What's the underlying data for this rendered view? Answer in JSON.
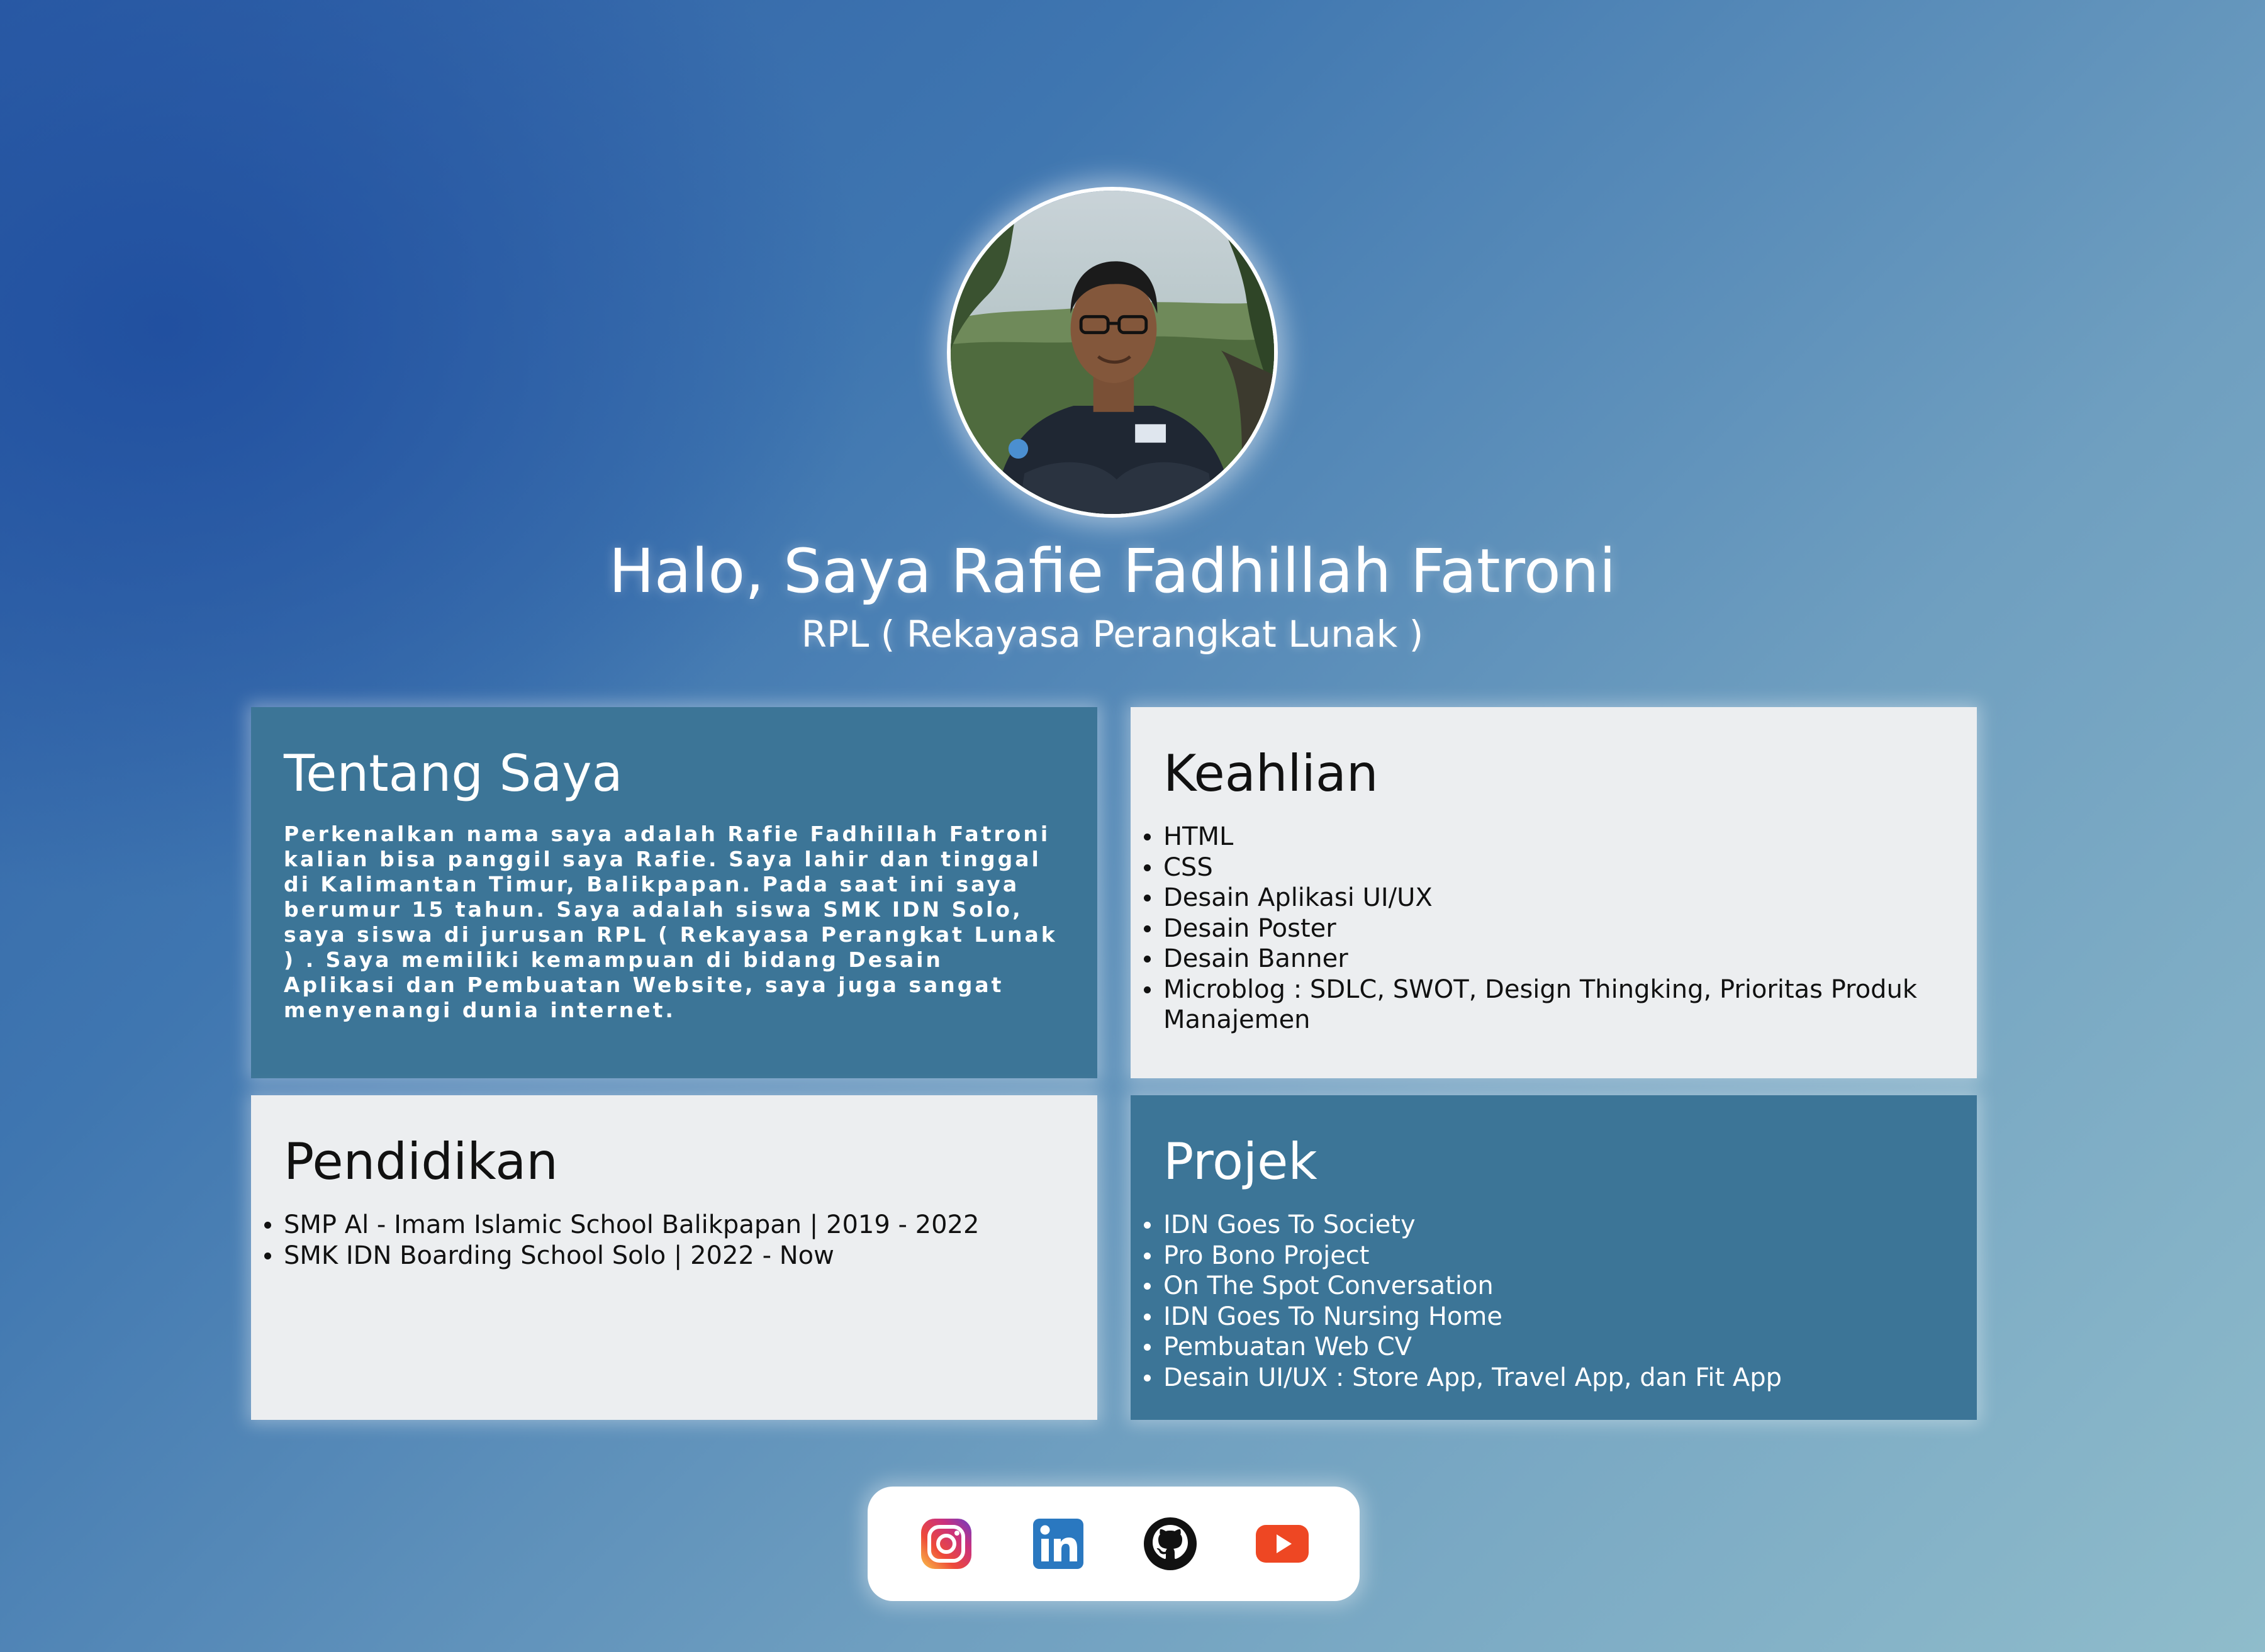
{
  "hero": {
    "name": "Halo, Saya Rafie Fadhillah Fatroni",
    "subtitle": "RPL ( Rekayasa Perangkat Lunak )",
    "avatar_alt": "profile-photo"
  },
  "about": {
    "title": "Tentang Saya",
    "text": "Perkenalkan nama saya adalah Rafie Fadhillah Fatroni kalian bisa panggil saya Rafie. Saya lahir dan tinggal di Kalimantan Timur, Balikpapan. Pada saat ini saya berumur 15 tahun. Saya adalah siswa SMK IDN Solo, saya siswa di jurusan RPL ( Rekayasa Perangkat Lunak ) . Saya memiliki kemampuan di bidang Desain Aplikasi dan Pembuatan Website, saya juga sangat menyenangi dunia internet."
  },
  "skills": {
    "title": "Keahlian",
    "items": [
      "HTML",
      "CSS",
      "Desain Aplikasi UI/UX",
      "Desain Poster",
      "Desain Banner",
      "Microblog : SDLC, SWOT, Design Thingking, Prioritas Produk Manajemen"
    ]
  },
  "education": {
    "title": "Pendidikan",
    "items": [
      "SMP Al - Imam Islamic School Balikpapan | 2019 - 2022",
      "SMK IDN Boarding School Solo | 2022 - Now"
    ]
  },
  "projects": {
    "title": "Projek",
    "items": [
      "IDN Goes To Society",
      "Pro Bono Project",
      "On The Spot Conversation",
      "IDN Goes To Nursing Home",
      "Pembuatan Web CV",
      "Desain UI/UX : Store App, Travel App, dan Fit App"
    ]
  },
  "socials": {
    "icons": [
      "instagram-icon",
      "linkedin-icon",
      "github-icon",
      "youtube-icon"
    ]
  },
  "colors": {
    "card_blue": "#3c7597",
    "card_light": "#eceef0",
    "youtube_red": "#ee4723",
    "linkedin_blue": "#2a78c0"
  }
}
